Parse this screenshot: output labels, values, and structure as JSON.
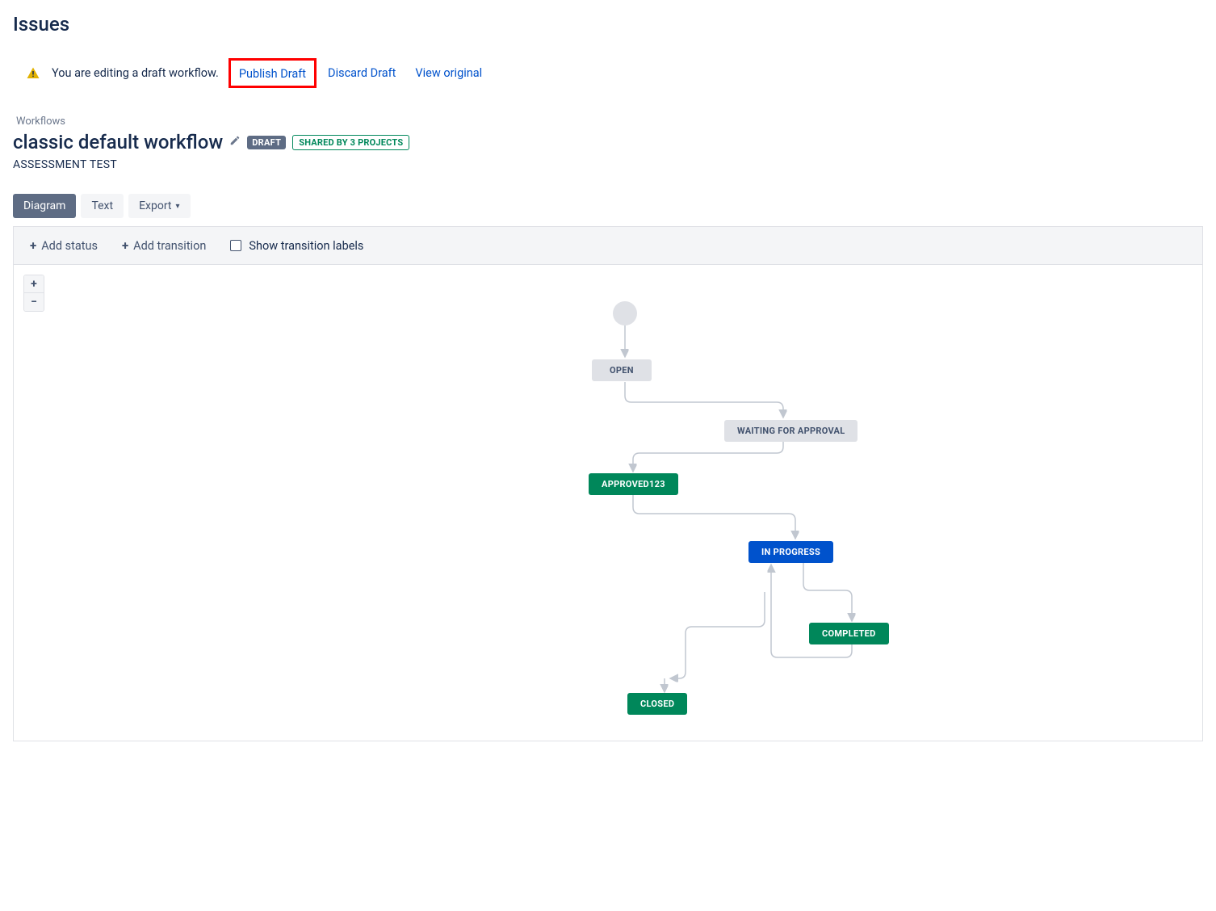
{
  "page_title": "Issues",
  "banner": {
    "text": "You are editing a draft workflow.",
    "publish": "Publish Draft",
    "discard": "Discard Draft",
    "view_original": "View original"
  },
  "breadcrumb": "Workflows",
  "workflow": {
    "title": "classic default workflow",
    "draft_badge": "DRAFT",
    "shared_badge": "SHARED BY 3 PROJECTS",
    "subtitle": "ASSESSMENT TEST"
  },
  "tabs": {
    "diagram": "Diagram",
    "text": "Text",
    "export": "Export"
  },
  "toolbar": {
    "add_status": "Add status",
    "add_transition": "Add transition",
    "show_labels": "Show transition labels"
  },
  "zoom": {
    "in": "+",
    "out": "−"
  },
  "nodes": {
    "open": "OPEN",
    "waiting": "WAITING FOR APPROVAL",
    "approved": "APPROVED123",
    "in_progress": "IN PROGRESS",
    "completed": "COMPLETED",
    "closed": "CLOSED"
  }
}
